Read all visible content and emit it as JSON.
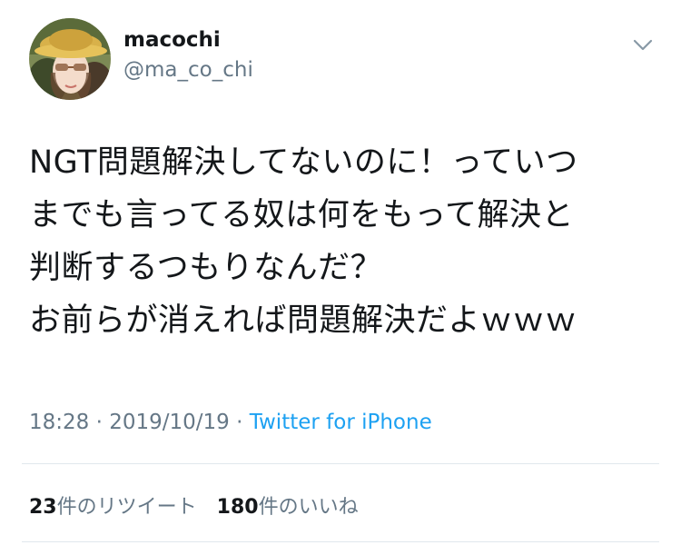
{
  "user": {
    "display_name": "macochi",
    "handle": "@ma_co_chi"
  },
  "tweet": {
    "text": "NGT問題解決してないのに！っていつ\nまでも言ってる奴は何をもって解決と\n判断するつもりなんだ？\nお前らが消えれば問題解決だよｗｗｗ"
  },
  "meta": {
    "time": "18:28",
    "separator": " · ",
    "date": "2019/10/19",
    "source": "Twitter for iPhone"
  },
  "stats": {
    "retweets_count": "23",
    "retweets_label": "件のリツイート",
    "likes_count": "180",
    "likes_label": "件のいいね"
  },
  "colors": {
    "accent": "#1da1f2",
    "secondary_text": "#657786",
    "primary_text": "#14171a",
    "divider": "#e1e8ed"
  },
  "icons": {
    "menu": "chevron-down-icon"
  }
}
